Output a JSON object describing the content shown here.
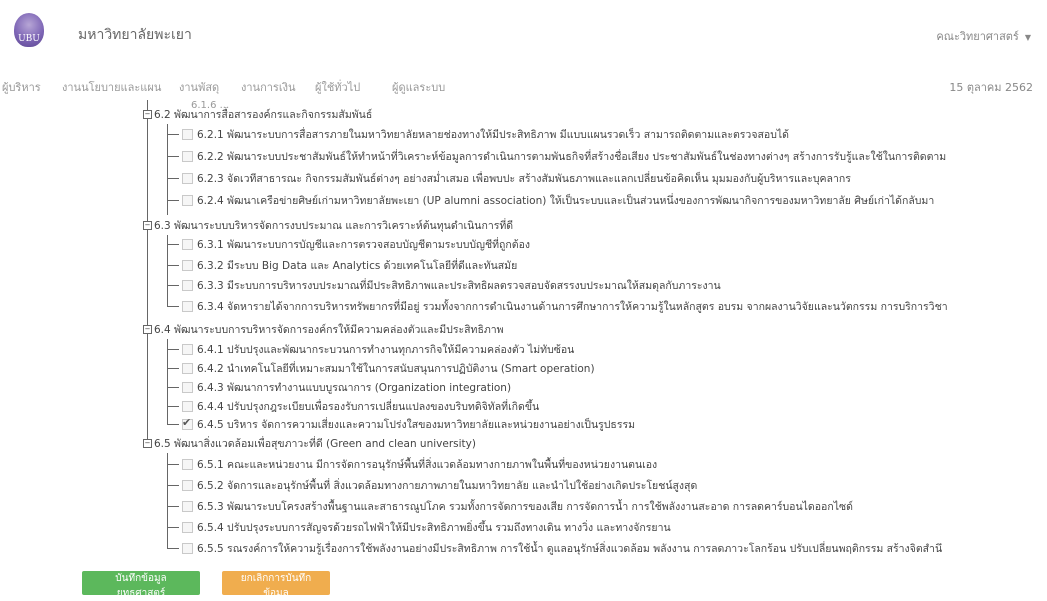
{
  "header": {
    "logo_text": "UBU",
    "university": "มหาวิทยาลัยพะเยา",
    "faculty": "คณะวิทยาศาสตร์"
  },
  "nav": {
    "items": [
      "ผู้บริหาร",
      "งานนโยบายและแผน",
      "งานพัสดุ",
      "งานการเงิน",
      "ผู้ใช้ทั่วไป",
      "ผู้ดูแลระบบ"
    ],
    "date": "15 ตุลาคม 2562"
  },
  "tree": {
    "partial_top": "6.1.6 ...",
    "groups": [
      {
        "label": "6.2 พัฒนาการสื่อสารองค์กรและกิจกรรมสัมพันธ์",
        "items": [
          {
            "label": "6.2.1 พัฒนาระบบการสื่อสารภายในมหาวิทยาลัยหลายช่องทางให้มีประสิทธิภาพ มีแบบแผนรวดเร็ว สามารถติดตามและตรวจสอบได้",
            "checked": false
          },
          {
            "label": "6.2.2 พัฒนาระบบประชาสัมพันธ์ให้ทำหน้าที่วิเคราะห์ข้อมูลการดำเนินการตามพันธกิจที่สร้างชื่อเสียง ประชาสัมพันธ์ในช่องทางต่างๆ สร้างการรับรู้และใช้ในการติดตาม",
            "checked": false
          },
          {
            "label": "6.2.3 จัดเวทีสาธารณะ กิจกรรมสัมพันธ์ต่างๆ อย่างสม่ำเสมอ เพื่อพบปะ สร้างสัมพันธภาพและแลกเปลี่ยนข้อคิดเห็น มุมมองกับผู้บริหารและบุคลากร",
            "checked": false
          },
          {
            "label": "6.2.4 พัฒนาเครือข่ายศิษย์เก่ามหาวิทยาลัยพะเยา (UP alumni association) ให้เป็นระบบและเป็นส่วนหนึ่งของการพัฒนากิจการของมหาวิทยาลัย ศิษย์เก่าได้กลับมา",
            "checked": false
          }
        ]
      },
      {
        "label": "6.3 พัฒนาระบบบริหารจัดการงบประมาณ และการวิเคราะห์ต้นทุนดำเนินการที่ดี",
        "items": [
          {
            "label": "6.3.1 พัฒนาระบบการบัญชีและการตรวจสอบบัญชีตามระบบบัญชีที่ถูกต้อง",
            "checked": false
          },
          {
            "label": "6.3.2 มีระบบ Big Data และ Analytics ด้วยเทคโนโลยีที่ดีและทันสมัย",
            "checked": false
          },
          {
            "label": "6.3.3 มีระบบการบริหารงบประมาณที่มีประสิทธิภาพและประสิทธิผลตรวจสอบจัดสรรงบประมาณให้สมดุลกับภาระงาน",
            "checked": false
          },
          {
            "label": "6.3.4 จัดหารายได้จากการบริหารทรัพยากรที่มีอยู่ รวมทั้งจากการดำเนินงานด้านการศึกษาการให้ความรู้ในหลักสูตร อบรม จากผลงานวิจัยและนวัตกรรม การบริการวิชา",
            "checked": false
          }
        ]
      },
      {
        "label": "6.4 พัฒนาระบบการบริหารจัดการองค์กรให้มีความคล่องตัวและมีประสิทธิภาพ",
        "items": [
          {
            "label": "6.4.1 ปรับปรุงและพัฒนากระบวนการทำงานทุกภารกิจให้มีความคล่องตัว ไม่ทับซ้อน",
            "checked": false
          },
          {
            "label": "6.4.2 นำเทคโนโลยีที่เหมาะสมมาใช้ในการสนับสนุนการปฏิบัติงาน (Smart operation)",
            "checked": false
          },
          {
            "label": "6.4.3 พัฒนาการทำงานแบบบูรณาการ (Organization integration)",
            "checked": false
          },
          {
            "label": "6.4.4 ปรับปรุงกฎระเบียบเพื่อรองรับการเปลี่ยนแปลงของบริบทดิจิทัลที่เกิดขึ้น",
            "checked": false
          },
          {
            "label": "6.4.5 บริหาร จัดการความเสี่ยงและความโปร่งใสของมหาวิทยาลัยและหน่วยงานอย่างเป็นรูปธรรม",
            "checked": true
          }
        ]
      },
      {
        "label": "6.5 พัฒนาสิ่งแวดล้อมเพื่อสุขภาวะที่ดี (Green and clean university)",
        "items": [
          {
            "label": "6.5.1 คณะและหน่วยงาน มีการจัดการอนุรักษ์พื้นที่สิ่งแวดล้อมทางกายภาพในพื้นที่ของหน่วยงานตนเอง",
            "checked": false
          },
          {
            "label": "6.5.2 จัดการและอนุรักษ์พื้นที่ สิ่งแวดล้อมทางกายภาพภายในมหาวิทยาลัย และนำไปใช้อย่างเกิดประโยชน์สูงสุด",
            "checked": false
          },
          {
            "label": "6.5.3 พัฒนาระบบโครงสร้างพื้นฐานและสาธารณูปโภค รวมทั้งการจัดการของเสีย การจัดการน้ำ การใช้พลังงานสะอาด การลดคาร์บอนไดออกไซด์",
            "checked": false
          },
          {
            "label": "6.5.4 ปรับปรุงระบบการสัญจรด้วยรถไฟฟ้าให้มีประสิทธิภาพยิ่งขึ้น รวมถึงทางเดิน ทางวิ่ง และทางจักรยาน",
            "checked": false
          },
          {
            "label": "6.5.5 รณรงค์การให้ความรู้เรื่องการใช้พลังงานอย่างมีประสิทธิภาพ การใช้น้ำ ดูแลอนุรักษ์สิ่งแวดล้อม พลังงาน การลดภาวะโลกร้อน ปรับเปลี่ยนพฤติกรรม สร้างจิตสำนึ",
            "checked": false
          }
        ]
      }
    ]
  },
  "buttons": {
    "save": "บันทึกข้อมูลยุทธศาสตร์",
    "cancel": "ยกเลิกการบันทึกข้อมูล"
  }
}
